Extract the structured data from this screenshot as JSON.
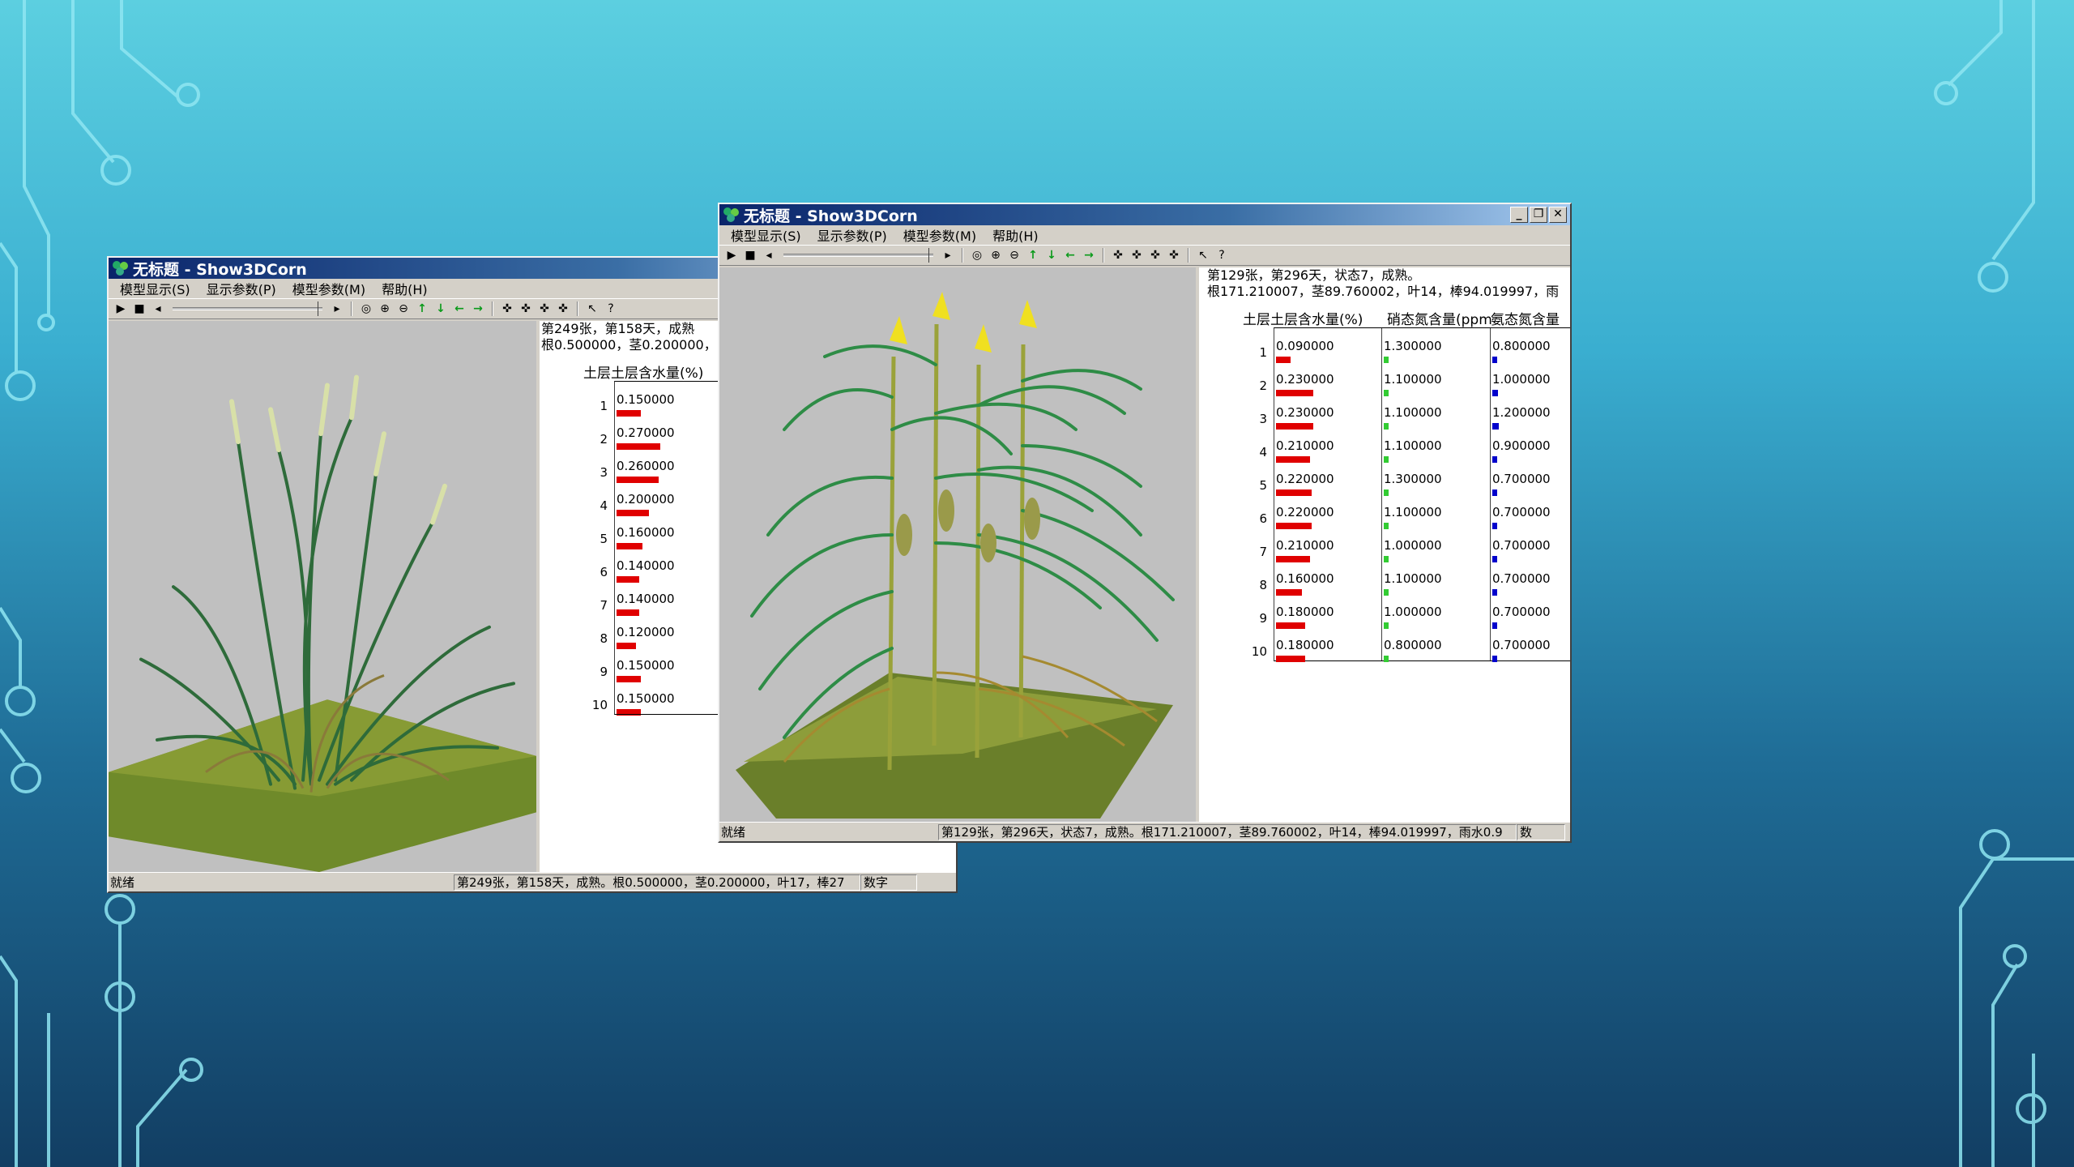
{
  "colors": {
    "moisture": "#e00000",
    "nitrate": "#33cc33",
    "ammonium": "#0000cc"
  },
  "win1": {
    "title": "无标题 - Show3DCorn",
    "menu": [
      "模型显示(S)",
      "显示参数(P)",
      "模型参数(M)",
      "帮助(H)"
    ],
    "info1": "第249张，第158天，成熟",
    "info2": "根0.500000，茎0.200000，",
    "header": "土层土层含水量(%)",
    "rows": [
      {
        "n": "1",
        "v": "0.150000",
        "f": 0.15
      },
      {
        "n": "2",
        "v": "0.270000",
        "f": 0.27
      },
      {
        "n": "3",
        "v": "0.260000",
        "f": 0.26
      },
      {
        "n": "4",
        "v": "0.200000",
        "f": 0.2
      },
      {
        "n": "5",
        "v": "0.160000",
        "f": 0.16
      },
      {
        "n": "6",
        "v": "0.140000",
        "f": 0.14
      },
      {
        "n": "7",
        "v": "0.140000",
        "f": 0.14
      },
      {
        "n": "8",
        "v": "0.120000",
        "f": 0.12
      },
      {
        "n": "9",
        "v": "0.150000",
        "f": 0.15
      },
      {
        "n": "10",
        "v": "0.150000",
        "f": 0.15
      }
    ],
    "status_ready": "就绪",
    "status_text": "第249张，第158天，成熟。根0.500000，茎0.200000，叶17，棒27",
    "status_mode": "数字"
  },
  "win2": {
    "title": "无标题 - Show3DCorn",
    "menu": [
      "模型显示(S)",
      "显示参数(P)",
      "模型参数(M)",
      "帮助(H)"
    ],
    "info1": "第129张，第296天，状态7，成熟。",
    "info2": "根171.210007，茎89.760002，叶14，棒94.019997，雨",
    "header1": "土层土层含水量(%)",
    "header2": "硝态氮含量(ppm)",
    "header3": "氨态氮含量",
    "rows": [
      {
        "n": "1",
        "m": "0.090000",
        "mf": 0.09,
        "no": "1.300000",
        "nof": 0.05,
        "nh": "0.800000",
        "nhf": 0.05
      },
      {
        "n": "2",
        "m": "0.230000",
        "mf": 0.23,
        "no": "1.100000",
        "nof": 0.05,
        "nh": "1.000000",
        "nhf": 0.06
      },
      {
        "n": "3",
        "m": "0.230000",
        "mf": 0.23,
        "no": "1.100000",
        "nof": 0.05,
        "nh": "1.200000",
        "nhf": 0.07
      },
      {
        "n": "4",
        "m": "0.210000",
        "mf": 0.21,
        "no": "1.100000",
        "nof": 0.05,
        "nh": "0.900000",
        "nhf": 0.05
      },
      {
        "n": "5",
        "m": "0.220000",
        "mf": 0.22,
        "no": "1.300000",
        "nof": 0.05,
        "nh": "0.700000",
        "nhf": 0.05
      },
      {
        "n": "6",
        "m": "0.220000",
        "mf": 0.22,
        "no": "1.100000",
        "nof": 0.05,
        "nh": "0.700000",
        "nhf": 0.05
      },
      {
        "n": "7",
        "m": "0.210000",
        "mf": 0.21,
        "no": "1.000000",
        "nof": 0.05,
        "nh": "0.700000",
        "nhf": 0.05
      },
      {
        "n": "8",
        "m": "0.160000",
        "mf": 0.16,
        "no": "1.100000",
        "nof": 0.05,
        "nh": "0.700000",
        "nhf": 0.05
      },
      {
        "n": "9",
        "m": "0.180000",
        "mf": 0.18,
        "no": "1.000000",
        "nof": 0.05,
        "nh": "0.700000",
        "nhf": 0.05
      },
      {
        "n": "10",
        "m": "0.180000",
        "mf": 0.18,
        "no": "0.800000",
        "nof": 0.05,
        "nh": "0.700000",
        "nhf": 0.05
      }
    ],
    "status_ready": "就绪",
    "status_text": "第129张，第296天，状态7，成熟。根171.210007，茎89.760002，叶14，棒94.019997，雨水0.9",
    "status_mode": "数"
  }
}
